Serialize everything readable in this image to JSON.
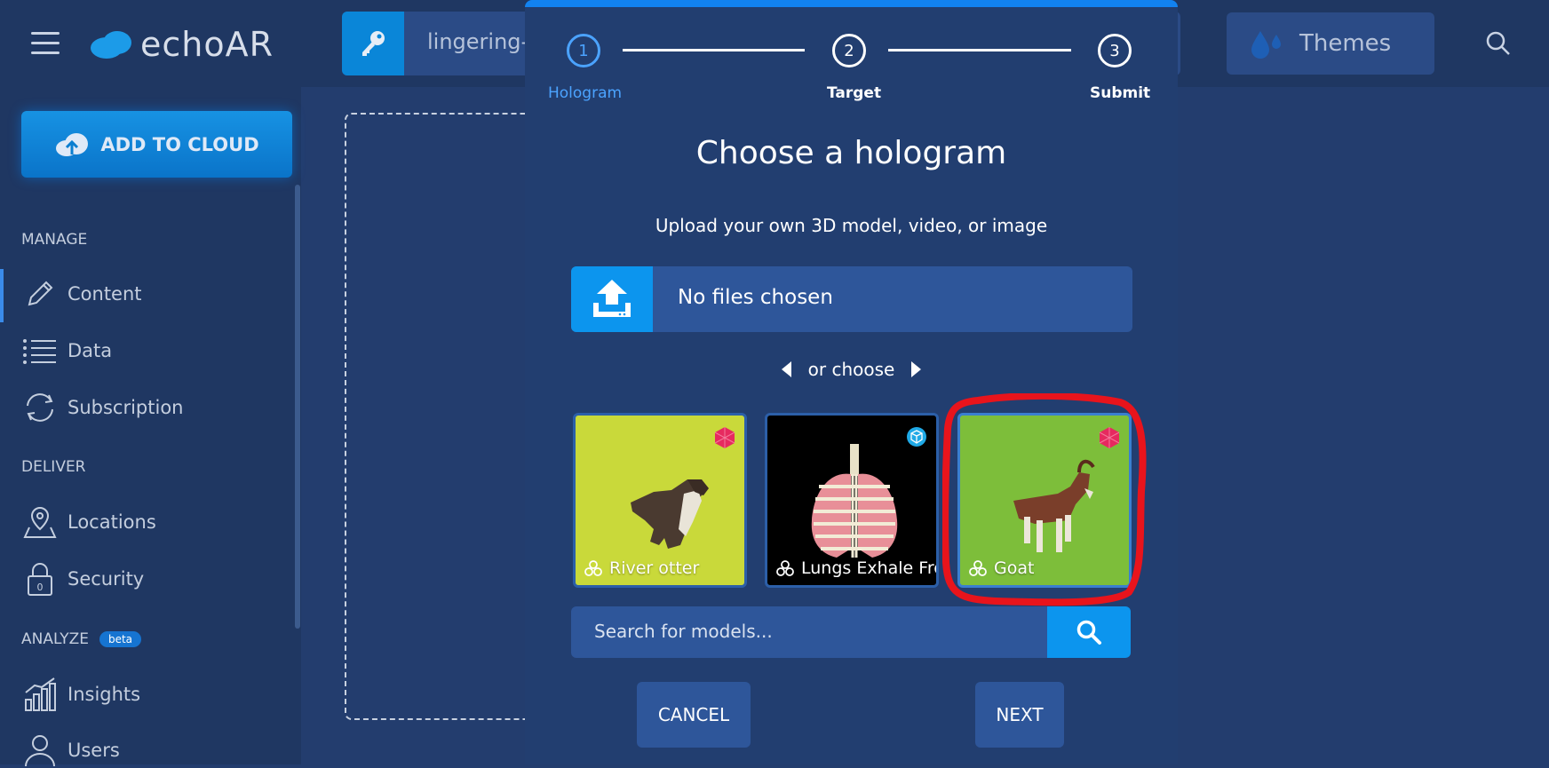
{
  "app": {
    "logo_text": "echoAR",
    "api_key": "lingering-p",
    "themes_label": "Themes"
  },
  "sidebar": {
    "add_to_cloud": "ADD TO CLOUD",
    "sections": {
      "manage": "MANAGE",
      "deliver": "DELIVER",
      "analyze": "ANALYZE",
      "beta": "beta"
    },
    "items": [
      {
        "label": "Content",
        "icon": "pencil-icon"
      },
      {
        "label": "Data",
        "icon": "list-icon"
      },
      {
        "label": "Subscription",
        "icon": "refresh-icon"
      },
      {
        "label": "Locations",
        "icon": "map-pin-icon"
      },
      {
        "label": "Security",
        "icon": "lock-icon"
      },
      {
        "label": "Insights",
        "icon": "bar-chart-icon"
      },
      {
        "label": "Users",
        "icon": "user-icon"
      }
    ]
  },
  "modal": {
    "steps": [
      {
        "number": "1",
        "label": "Hologram",
        "active": true
      },
      {
        "number": "2",
        "label": "Target",
        "active": false
      },
      {
        "number": "3",
        "label": "Submit",
        "active": false
      }
    ],
    "title": "Choose a hologram",
    "subtitle": "Upload your own 3D model, video, or image",
    "upload_text": "No files chosen",
    "or_choose": "or choose",
    "cards": [
      {
        "name": "River otter",
        "bg": "#c9d93a",
        "badge": "gem-icon"
      },
      {
        "name": "Lungs Exhale Fro",
        "bg": "#000000",
        "badge": "cube-icon"
      },
      {
        "name": "Goat",
        "bg": "#7dbe3a",
        "badge": "gem-icon"
      }
    ],
    "search_placeholder": "Search for models...",
    "cancel_label": "CANCEL",
    "next_label": "NEXT"
  },
  "colors": {
    "accent": "#0c95ee",
    "highlight": "#e8141c",
    "active_step": "#4ba3ff"
  }
}
